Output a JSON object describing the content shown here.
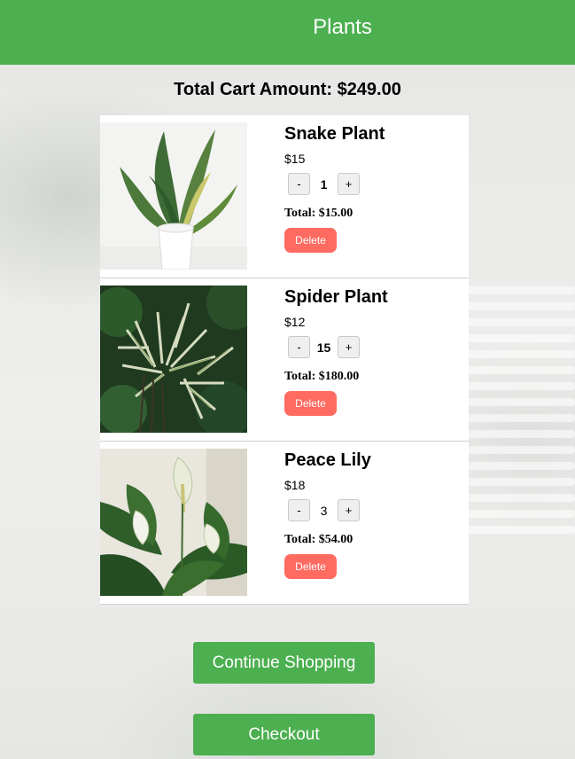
{
  "header": {
    "title": "Plants"
  },
  "cart": {
    "total_label": "Total Cart Amount: $249.00",
    "items": [
      {
        "name": "Snake Plant",
        "price": "$15",
        "minus": "-",
        "qty": "1",
        "plus": "+",
        "total": "Total: $15.00",
        "delete_label": "Delete"
      },
      {
        "name": "Spider Plant",
        "price": "$12",
        "minus": "-",
        "qty": "15",
        "plus": "+",
        "total": "Total: $180.00",
        "delete_label": "Delete"
      },
      {
        "name": "Peace Lily",
        "price": "$18",
        "minus": "-",
        "qty": "3",
        "plus": "+",
        "total": "Total: $54.00",
        "delete_label": "Delete"
      }
    ]
  },
  "actions": {
    "continue_label": "Continue Shopping",
    "checkout_label": "Checkout"
  },
  "colors": {
    "brand_green": "#4caf50",
    "delete_red": "#ff6b61"
  }
}
